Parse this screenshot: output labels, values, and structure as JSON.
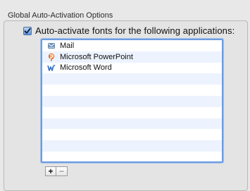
{
  "group": {
    "title": "Global Auto-Activation Options"
  },
  "auto_activate": {
    "label": "Auto-activate fonts for the following applications:",
    "checked": true
  },
  "applications": [
    {
      "name": "Mail",
      "icon": "mail-icon"
    },
    {
      "name": "Microsoft PowerPoint",
      "icon": "powerpoint-icon"
    },
    {
      "name": "Microsoft Word",
      "icon": "word-icon"
    },
    {
      "name": "",
      "icon": ""
    },
    {
      "name": "",
      "icon": ""
    },
    {
      "name": "",
      "icon": ""
    },
    {
      "name": "",
      "icon": ""
    },
    {
      "name": "",
      "icon": ""
    },
    {
      "name": "",
      "icon": ""
    },
    {
      "name": "",
      "icon": ""
    },
    {
      "name": "",
      "icon": ""
    }
  ],
  "buttons": {
    "add_label": "+",
    "remove_label": "−"
  },
  "colors": {
    "list_alt_row": "#edf3fe",
    "focus_ring": "#6e9ddf"
  }
}
